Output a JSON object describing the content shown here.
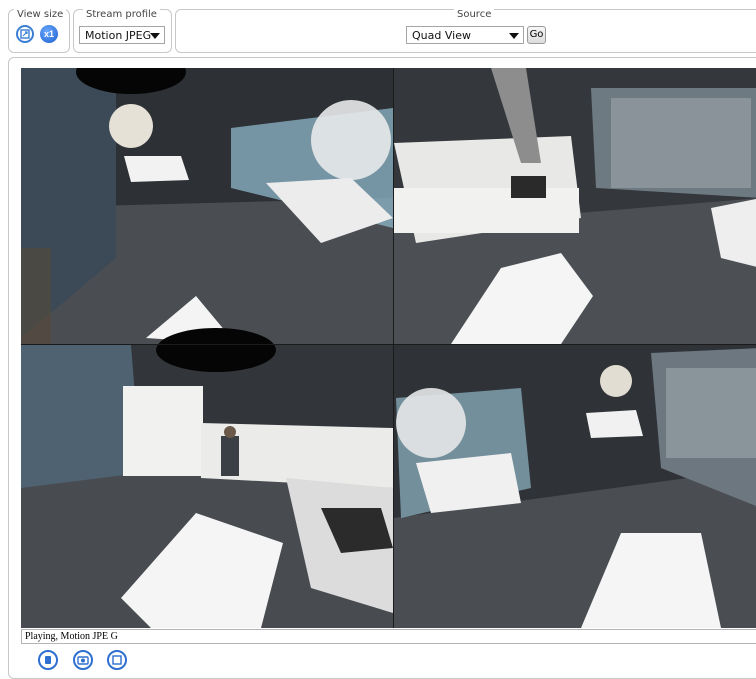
{
  "view_size": {
    "legend": "View size",
    "fit_icon": "fit-window-icon",
    "scale_label": "x1"
  },
  "stream_profile": {
    "legend": "Stream profile",
    "selected": "Motion JPEG"
  },
  "source": {
    "legend": "Source",
    "selected": "Quad View",
    "go_label": "Go"
  },
  "video": {
    "layout": "quad",
    "quadrants": [
      {
        "view": "top-left",
        "scene": "dining area with round lamp and white table"
      },
      {
        "view": "top-right",
        "scene": "kitchen counter with cabinets and sink"
      },
      {
        "view": "bottom-left",
        "scene": "kitchen corner with a person at the counter"
      },
      {
        "view": "bottom-right",
        "scene": "meeting table near glass walls"
      }
    ]
  },
  "status_bar": {
    "text": "Playing, Motion JPE G"
  },
  "bottom_toolbar": {
    "icons": [
      "stop-icon",
      "snapshot-icon",
      "fullscreen-icon"
    ]
  },
  "colors": {
    "accent": "#2e6fd0",
    "border": "#c8c8c8"
  }
}
